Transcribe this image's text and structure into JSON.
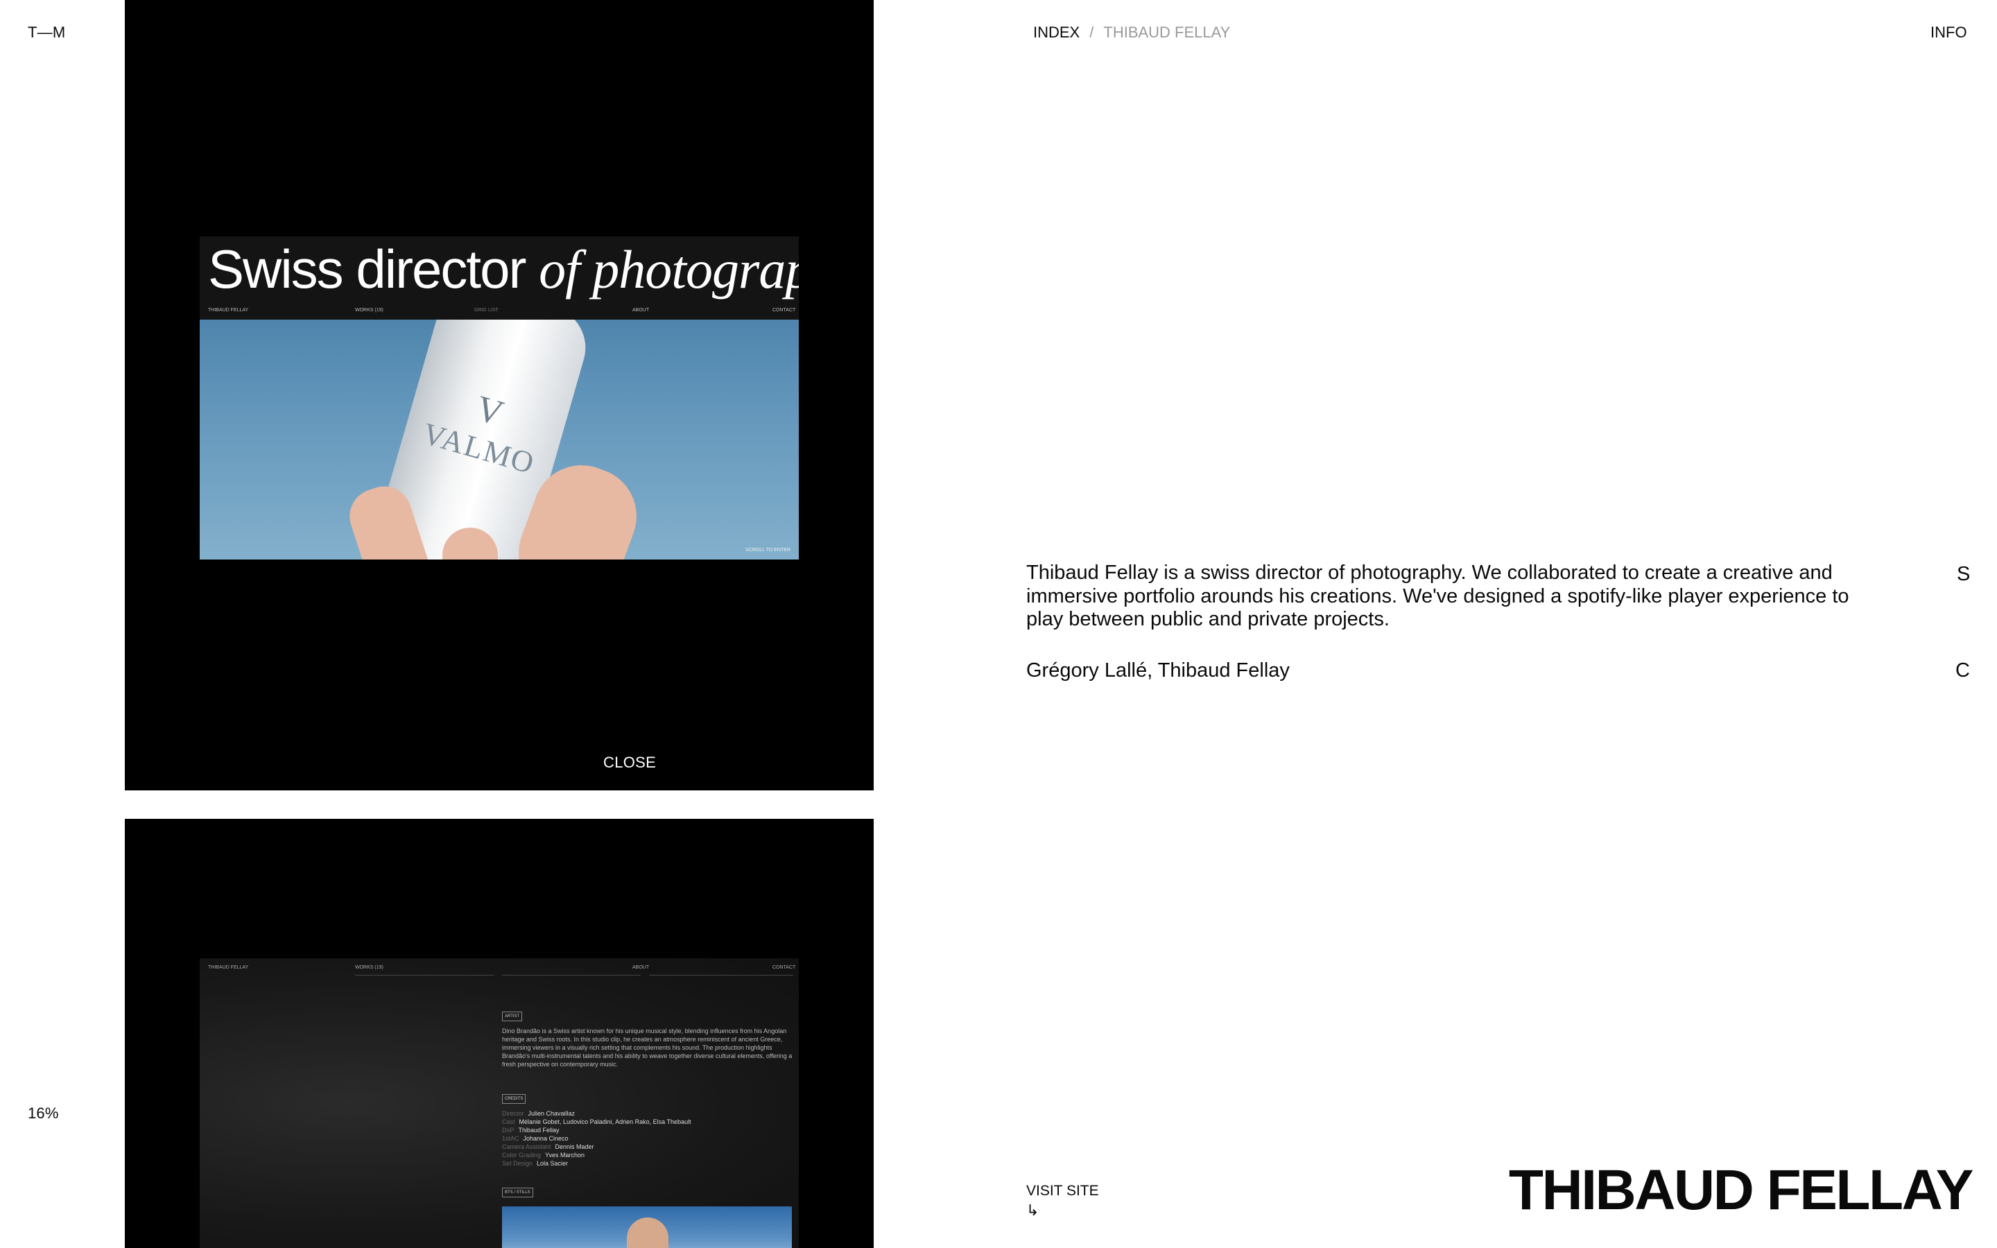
{
  "brand": {
    "logo": "T—M"
  },
  "progress": {
    "label": "16%"
  },
  "nav": {
    "index_label": "INDEX",
    "separator": "/",
    "current": "THIBAUD FELLAY",
    "info_label": "INFO"
  },
  "gallery": {
    "card1": {
      "headline_plain": "Swiss director ",
      "headline_italic": "of photography",
      "mini_nav": [
        "THIBAUD FELLAY",
        "WORKS (19)",
        "GRID",
        "LIST",
        "ABOUT",
        "CONTACT"
      ],
      "product_brand": "VALMO",
      "product_mark": "V",
      "caption": "SCROLL TO ENTER",
      "close_label": "CLOSE"
    },
    "card2": {
      "mini_nav": [
        "THIBAUD FELLAY",
        "WORKS (19)",
        "ABOUT",
        "CONTACT"
      ],
      "artist_tag": "ARTIST",
      "artist_text": "Dino Brandão is a Swiss artist known for his unique musical style, blending influences from his Angolan heritage and Swiss roots. In this studio clip, he creates an atmosphere reminiscent of ancient Greece, immersing viewers in a visually rich setting that complements his sound. The production highlights Brandão's multi-instrumental talents and his ability to weave together diverse cultural elements, offering a fresh perspective on contemporary music.",
      "credits_tag": "CREDITS",
      "credits": [
        {
          "role": "Director",
          "name": "Julien Chavaillaz"
        },
        {
          "role": "Cast",
          "name": "Mélanie Gobet, Ludovico Paladini, Adrien Rako, Elsa Thebault"
        },
        {
          "role": "DoP",
          "name": "Thibaud Fellay"
        },
        {
          "role": "1stAC",
          "name": "Johanna Cineco"
        },
        {
          "role": "Camera Assistant",
          "name": "Dennis Mader"
        },
        {
          "role": "Color Grading",
          "name": "Yves Marchon"
        },
        {
          "role": "Set Design",
          "name": "Lola Sacier"
        }
      ],
      "stills_tag": "BTS / STILLS"
    }
  },
  "project": {
    "description": "Thibaud Fellay is a swiss director of photography. We collaborated to create a creative and immersive portfolio arounds his creations. We've designed a spotify-like player experience to play between public and private projects.",
    "credits": "Grégory Lallé, Thibaud Fellay",
    "label_s": "S",
    "label_c": "C",
    "visit_label": "VISIT SITE",
    "visit_arrow": "↳",
    "title": "THIBAUD FELLAY"
  }
}
